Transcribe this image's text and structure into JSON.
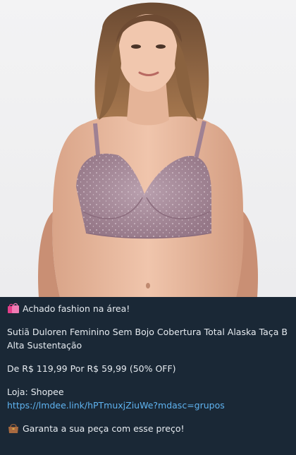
{
  "post": {
    "headline_emoji": "shopping-bags-icon",
    "headline": "Achado fashion na área!",
    "product_title": "Sutiã Duloren Feminino Sem Bojo Cobertura Total Alaska Taça B Alta Sustentação",
    "price_line": "De R$ 119,99 Por R$ 59,99 (50% OFF)",
    "store": "Loja: Shopee",
    "link": "https://lmdee.link/hPTmuxjZiuWe?mdasc=grupos",
    "cta_emoji": "handbag-icon",
    "cta": "Garanta a sua peça com esse preço!"
  },
  "colors": {
    "background": "#1a2836",
    "text": "#e6ebf0",
    "link": "#5fb3f0",
    "product": "#a88a9c"
  }
}
